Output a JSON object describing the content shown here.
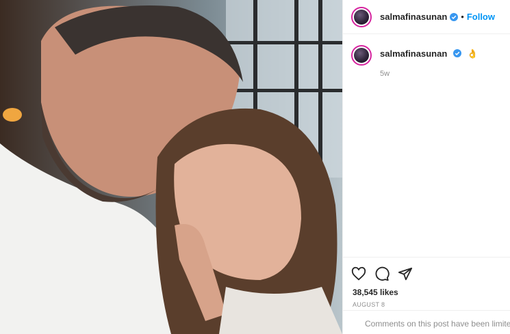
{
  "post": {
    "photo_alt": "",
    "username": "salmafinasunan",
    "dot": "•",
    "follow_label": "Follow",
    "caption_emoji": "👌",
    "time_ago": "5w",
    "likes": "38,545 likes",
    "date": "AUGUST 8",
    "comments_notice": "Comments on this post have been limited."
  },
  "icons": {
    "verified": "verified-badge-icon",
    "like": "heart-icon",
    "comment": "comment-icon",
    "share": "share-icon"
  },
  "colors": {
    "accent": "#0095f6",
    "text": "#262626",
    "muted": "#8e8e8e",
    "border": "#efefef",
    "ring": "#d6249f"
  }
}
